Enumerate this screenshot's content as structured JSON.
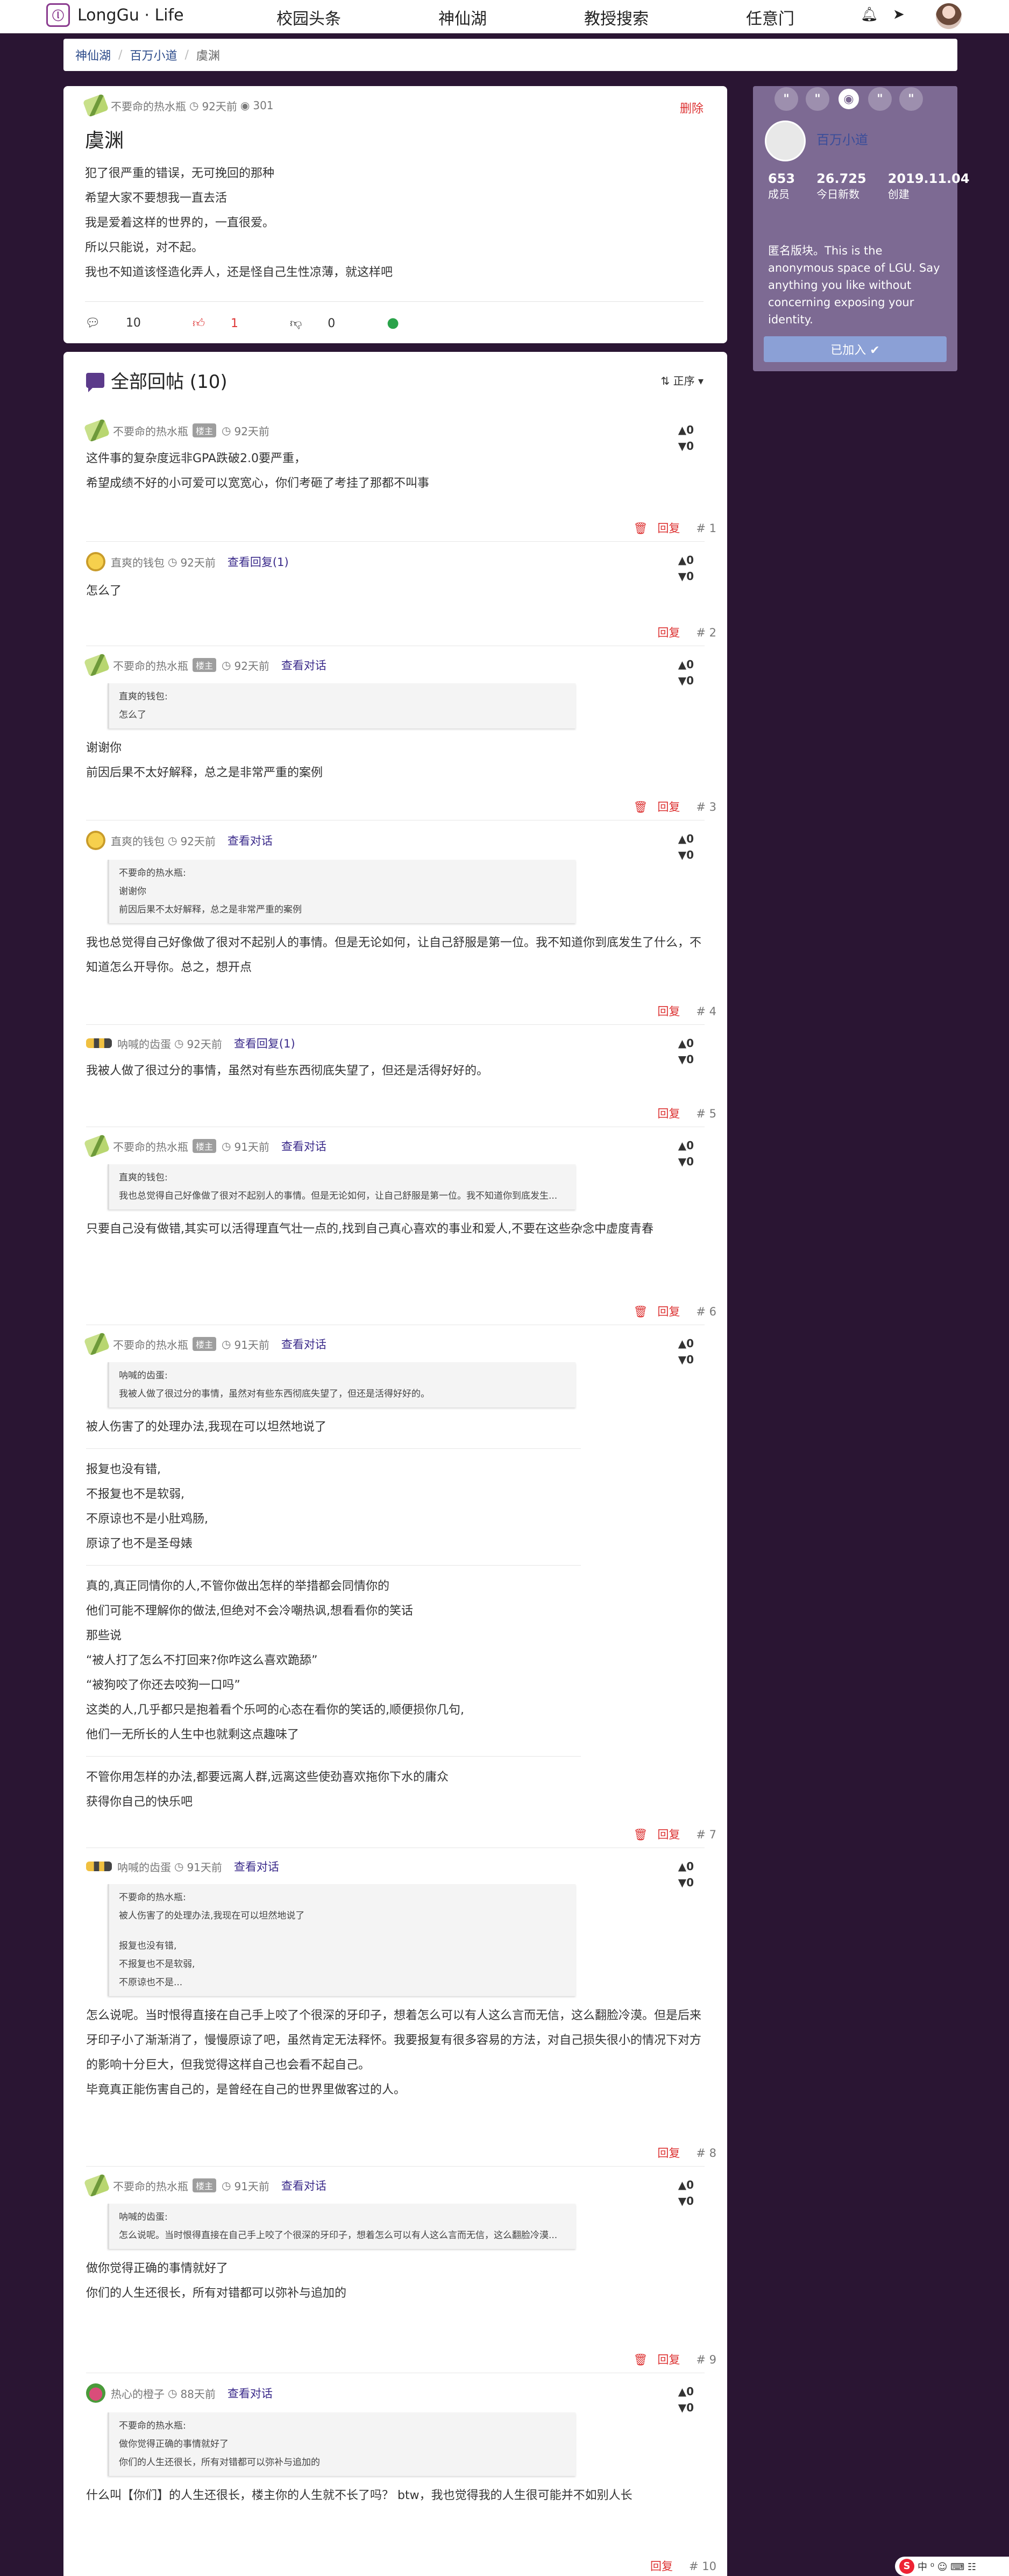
{
  "brand": {
    "name": "LongGu · Life",
    "logo_icon": "longgu-logo-icon"
  },
  "nav": {
    "items": [
      "校园头条",
      "神仙湖",
      "教授搜索",
      "任意门"
    ],
    "bell_icon": "bell-icon",
    "send_icon": "paper-plane-icon"
  },
  "breadcrumb": [
    "神仙湖",
    "百万小道",
    "虞渊"
  ],
  "post": {
    "author": "不要命的热水瓶",
    "time": "92天前",
    "views": "301",
    "delete_label": "删除",
    "title": "虞渊",
    "lines": [
      "犯了很严重的错误，无可挽回的那种",
      "希望大家不要想我一直去活",
      "我是爱着这样的世界的，一直很爱。",
      "所以只能说，对不起。",
      "我也不知道该怪造化弄人，还是怪自己生性凉薄，就这样吧"
    ],
    "actions": {
      "comments": "10",
      "up": "1",
      "down": "0"
    }
  },
  "replies_section": {
    "title": "全部回帖 (10)",
    "sort_label": "正序"
  },
  "replies": [
    {
      "author": "不要命的热水瓶",
      "badge": "楼主",
      "time": "92天前",
      "view_link": "",
      "up": "0",
      "down": "0",
      "reply_label": "回复",
      "num": "# 1",
      "quote_author": "",
      "quote_lines": [],
      "paragraphs": [
        [
          "这件事的复杂度远非GPA跌破2.0要严重，",
          "希望成绩不好的小可爱可以宽宽心，你们考砸了考挂了那都不叫事"
        ]
      ]
    },
    {
      "author": "直爽的钱包",
      "badge": "",
      "time": "92天前",
      "view_link": "查看回复(1)",
      "up": "0",
      "down": "0",
      "reply_label": "回复",
      "num": "# 2",
      "quote_author": "",
      "quote_lines": [],
      "paragraphs": [
        [
          "怎么了"
        ]
      ]
    },
    {
      "author": "不要命的热水瓶",
      "badge": "楼主",
      "time": "92天前",
      "view_link": "查看对话",
      "up": "0",
      "down": "0",
      "reply_label": "回复",
      "num": "# 3",
      "quote_author": "直爽的钱包:",
      "quote_lines": [
        "怎么了"
      ],
      "paragraphs": [
        [
          "谢谢你",
          "前因后果不太好解释，总之是非常严重的案例"
        ]
      ]
    },
    {
      "author": "直爽的钱包",
      "badge": "",
      "time": "92天前",
      "view_link": "查看对话",
      "up": "0",
      "down": "0",
      "reply_label": "回复",
      "num": "# 4",
      "quote_author": "不要命的热水瓶:",
      "quote_lines": [
        "谢谢你",
        "前因后果不太好解释，总之是非常严重的案例"
      ],
      "paragraphs": [
        [
          "我也总觉得自己好像做了很对不起别人的事情。但是无论如何，让自己舒服是第一位。我不知道你到底发生了什么，不知道怎么开导你。总之，想开点"
        ]
      ]
    },
    {
      "author": "呐喊的齿蛋",
      "badge": "",
      "time": "92天前",
      "view_link": "查看回复(1)",
      "up": "0",
      "down": "0",
      "reply_label": "回复",
      "num": "# 5",
      "quote_author": "",
      "quote_lines": [],
      "paragraphs": [
        [
          "我被人做了很过分的事情，虽然对有些东西彻底失望了，但还是活得好好的。"
        ]
      ]
    },
    {
      "author": "不要命的热水瓶",
      "badge": "楼主",
      "time": "91天前",
      "view_link": "查看对话",
      "up": "0",
      "down": "0",
      "reply_label": "回复",
      "num": "# 6",
      "quote_author": "直爽的钱包:",
      "quote_lines": [
        "我也总觉得自己好像做了很对不起别人的事情。但是无论如何，让自己舒服是第一位。我不知道你到底发生..."
      ],
      "paragraphs": [
        [
          "只要自己没有做错,其实可以活得理直气壮一点的,找到自己真心喜欢的事业和爱人,不要在这些杂念中虚度青春"
        ]
      ]
    },
    {
      "author": "不要命的热水瓶",
      "badge": "楼主",
      "time": "91天前",
      "view_link": "查看对话",
      "up": "0",
      "down": "0",
      "reply_label": "回复",
      "num": "# 7",
      "quote_author": "呐喊的齿蛋:",
      "quote_lines": [
        "我被人做了很过分的事情，虽然对有些东西彻底失望了，但还是活得好好的。"
      ],
      "paragraphs": [
        [
          "被人伤害了的处理办法,我现在可以坦然地说了"
        ],
        [
          "报复也没有错,",
          "不报复也不是软弱,",
          "不原谅也不是小肚鸡肠,",
          "原谅了也不是圣母婊"
        ],
        [
          "真的,真正同情你的人,不管你做出怎样的举措都会同情你的",
          "他们可能不理解你的做法,但绝对不会冷嘲热讽,想看看你的笑话",
          "那些说",
          "“被人打了怎么不打回来?你咋这么喜欢跪舔”",
          "“被狗咬了你还去咬狗一口吗”",
          "这类的人,几乎都只是抱着看个乐呵的心态在看你的笑话的,顺便损你几句,",
          "他们一无所长的人生中也就剩这点趣味了"
        ],
        [
          "不管你用怎样的办法,都要远离人群,远离这些使劲喜欢拖你下水的庸众",
          "获得你自己的快乐吧"
        ]
      ]
    },
    {
      "author": "呐喊的齿蛋",
      "badge": "",
      "time": "91天前",
      "view_link": "查看对话",
      "up": "0",
      "down": "0",
      "reply_label": "回复",
      "num": "# 8",
      "quote_author": "不要命的热水瓶:",
      "quote_lines": [
        "被人伤害了的处理办法,我现在可以坦然地说了",
        "",
        "报复也没有错,",
        "不报复也不是软弱,",
        "不原谅也不是..."
      ],
      "paragraphs": [
        [
          "怎么说呢。当时恨得直接在自己手上咬了个很深的牙印子，想着怎么可以有人这么言而无信，这么翻脸冷漠。但是后来牙印子小了渐渐消了，慢慢原谅了吧，虽然肯定无法释怀。我要报复有很多容易的方法，对自己损失很小的情况下对方的影响十分巨大，但我觉得这样自己也会看不起自己。",
          "毕竟真正能伤害自己的，是曾经在自己的世界里做客过的人。"
        ]
      ]
    },
    {
      "author": "不要命的热水瓶",
      "badge": "楼主",
      "time": "91天前",
      "view_link": "查看对话",
      "up": "0",
      "down": "0",
      "reply_label": "回复",
      "num": "# 9",
      "quote_author": "呐喊的齿蛋:",
      "quote_lines": [
        "怎么说呢。当时恨得直接在自己手上咬了个很深的牙印子，想着怎么可以有人这么言而无信，这么翻脸冷漠..."
      ],
      "paragraphs": [
        [
          "做你觉得正确的事情就好了",
          "你们的人生还很长，所有对错都可以弥补与追加的"
        ]
      ]
    },
    {
      "author": "热心的橙子",
      "badge": "",
      "time": "88天前",
      "view_link": "查看对话",
      "up": "0",
      "down": "0",
      "reply_label": "回复",
      "num": "# 10",
      "quote_author": "不要命的热水瓶:",
      "quote_lines": [
        "做你觉得正确的事情就好了",
        "你们的人生还很长，所有对错都可以弥补与追加的"
      ],
      "paragraphs": [
        [
          "什么叫【你们】的人生还很长，楼主你的人生就不长了吗？ btw，我也觉得我的人生很可能并不如别人长"
        ]
      ]
    }
  ],
  "side": {
    "name": "百万小道",
    "stats": [
      {
        "value": "653",
        "label": "成员"
      },
      {
        "value": "26.725",
        "label": "今日新数"
      },
      {
        "value": "2019.11.04",
        "label": "创建"
      }
    ],
    "description": "匿名版块。This is the anonymous space of LGU. Say anything you like without concerning exposing your identity.",
    "joined_label": "已加入 ✔"
  },
  "colors": {
    "background": "#2a1533",
    "side_card": "#7d6a93",
    "accent_red": "#dd3333",
    "link_blue": "#3a2a8a"
  }
}
